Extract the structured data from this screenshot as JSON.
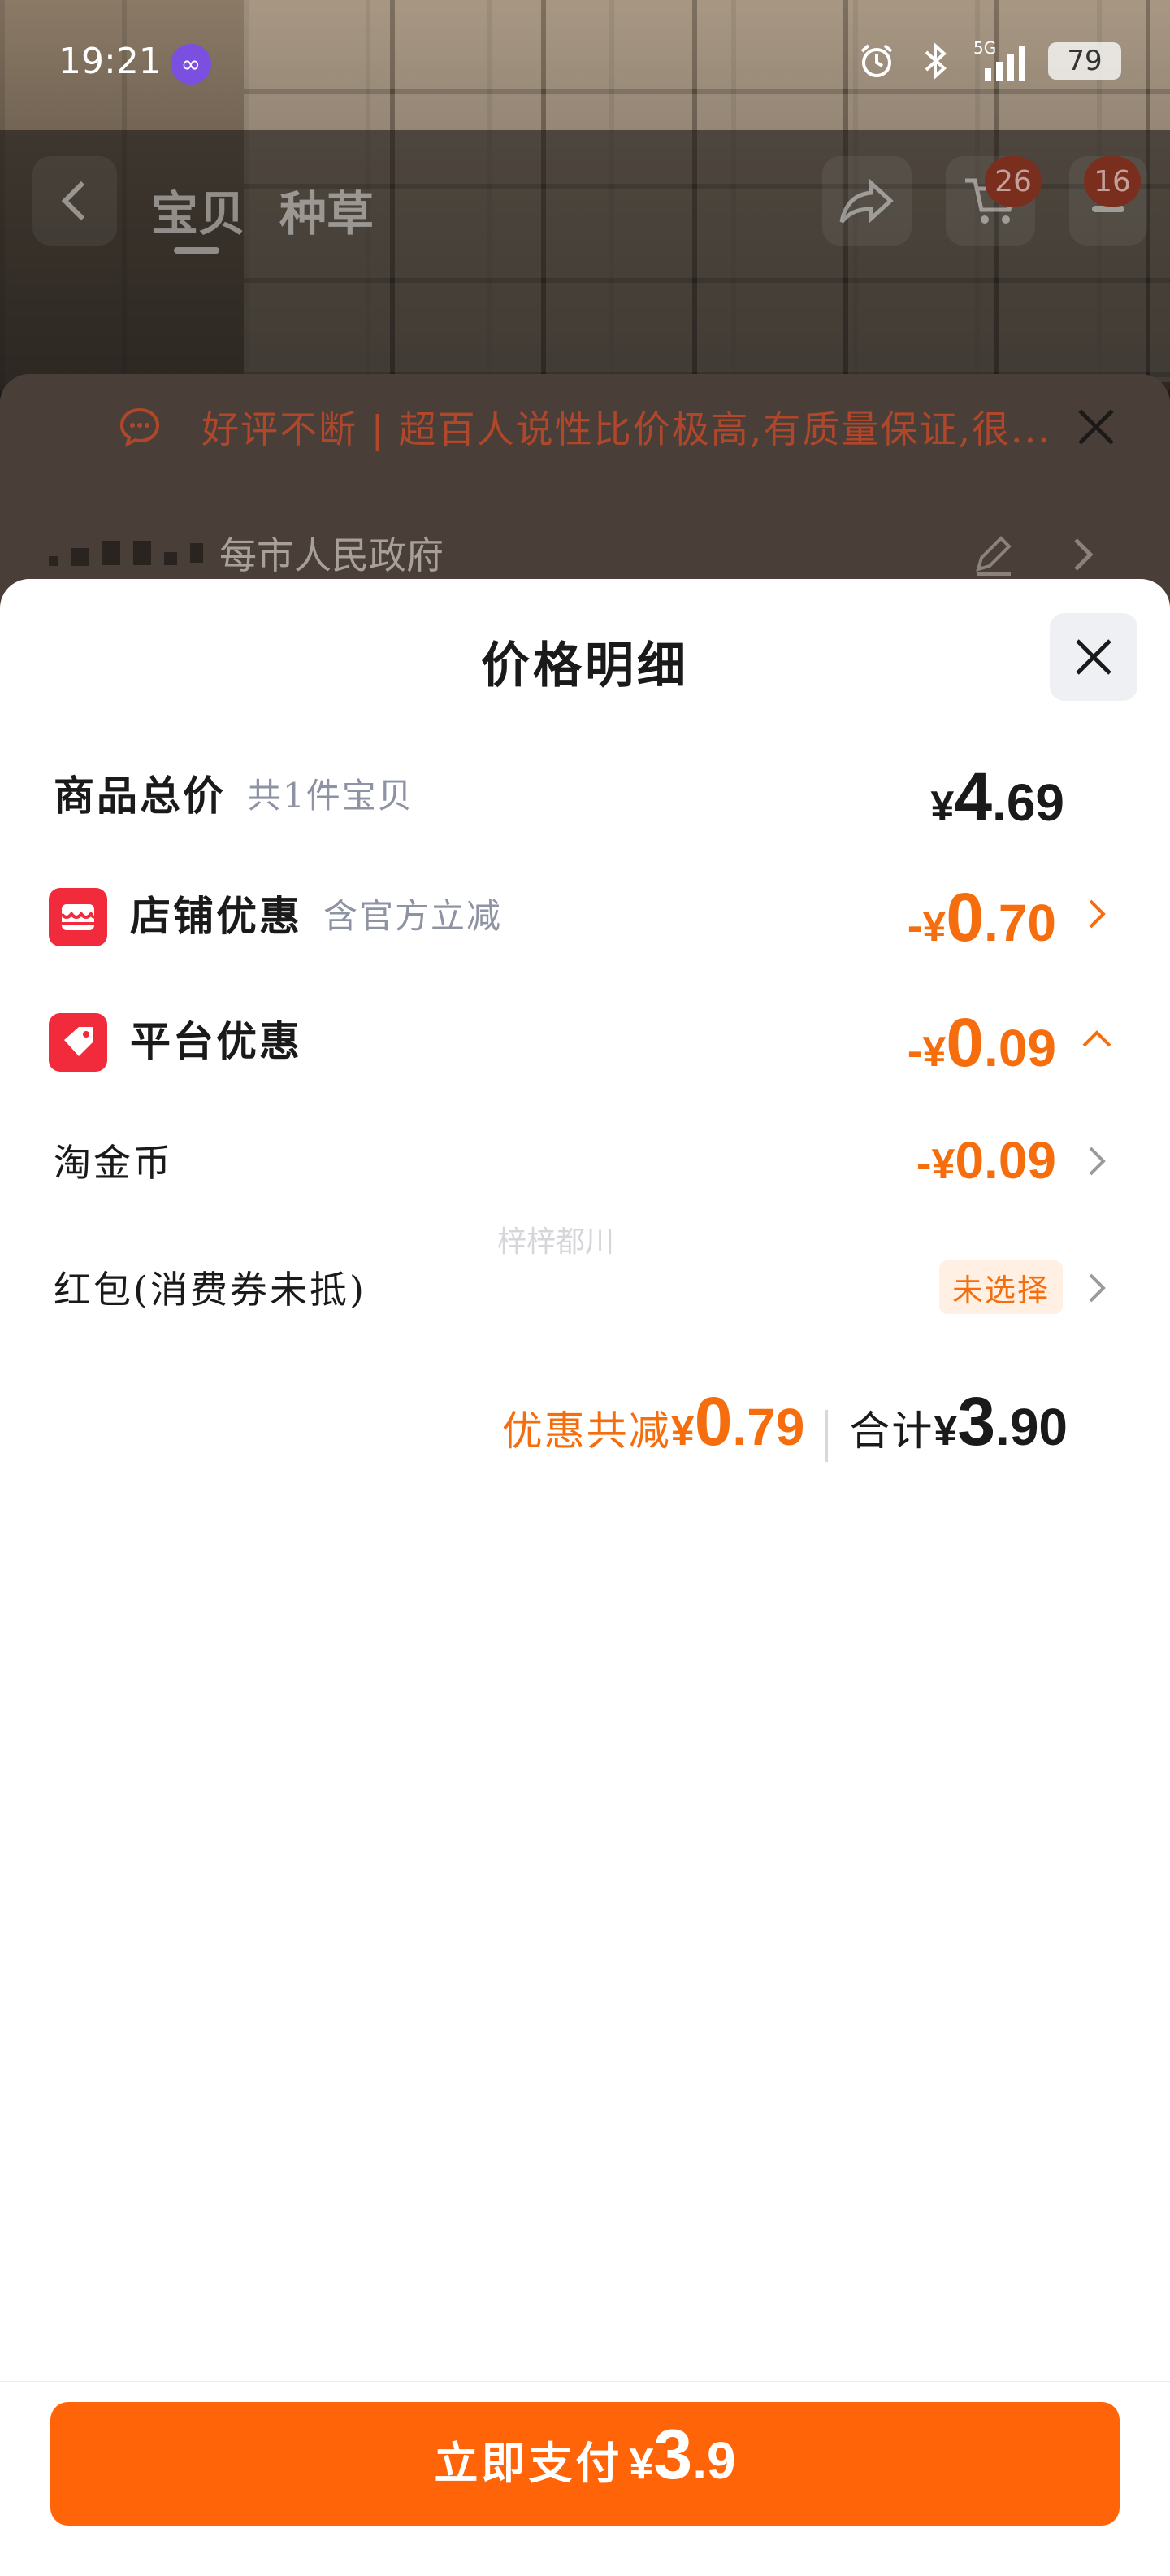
{
  "status_bar": {
    "time": "19:21",
    "battery": "79",
    "network": "5G",
    "icons": [
      "app-infinity-icon",
      "alarm-icon",
      "bluetooth-icon",
      "signal-icon",
      "battery-icon"
    ]
  },
  "nav": {
    "tabs": [
      "宝贝",
      "种草"
    ],
    "cart_badge": "26",
    "menu_badge": "16",
    "icons": [
      "back-icon",
      "share-icon",
      "cart-icon",
      "more-icon"
    ]
  },
  "review_banner": {
    "text": "好评不断 | 超百人说性比价极高,有质量保证,很..."
  },
  "address": {
    "text": "每市人民政府"
  },
  "sheet": {
    "title": "价格明细",
    "rows": {
      "total": {
        "label": "商品总价",
        "sub": "共1件宝贝",
        "yen": "¥",
        "int": "4",
        "dec": ".69"
      },
      "shop": {
        "label": "店铺优惠",
        "sub": "含官方立减",
        "sign": "-",
        "yen": "¥",
        "int": "0",
        "dec": ".70"
      },
      "platform": {
        "label": "平台优惠",
        "sign": "-",
        "yen": "¥",
        "int": "0",
        "dec": ".09"
      },
      "coins": {
        "label": "淘金币",
        "sign": "-",
        "yen": "¥",
        "int": "0",
        "dec": ".09"
      },
      "redpacket": {
        "label": "红包(消费券未抵)",
        "badge": "未选择"
      }
    },
    "watermark": "梓梓都川",
    "summary": {
      "discount_label": "优惠共减",
      "discount_yen": "¥",
      "discount_int": "0",
      "discount_dec": ".79",
      "total_label": "合计",
      "total_yen": "¥",
      "total_int": "3",
      "total_dec": ".90"
    }
  },
  "pay_button": {
    "label": "立即支付",
    "yen": "¥",
    "int": "3",
    "dec": ".9"
  },
  "colors": {
    "accent_orange": "#ff6508",
    "discount_orange": "#f56d0c",
    "icon_red": "#f12a3c",
    "text_dark": "#1a1a1a",
    "text_muted": "#8d93a3"
  }
}
